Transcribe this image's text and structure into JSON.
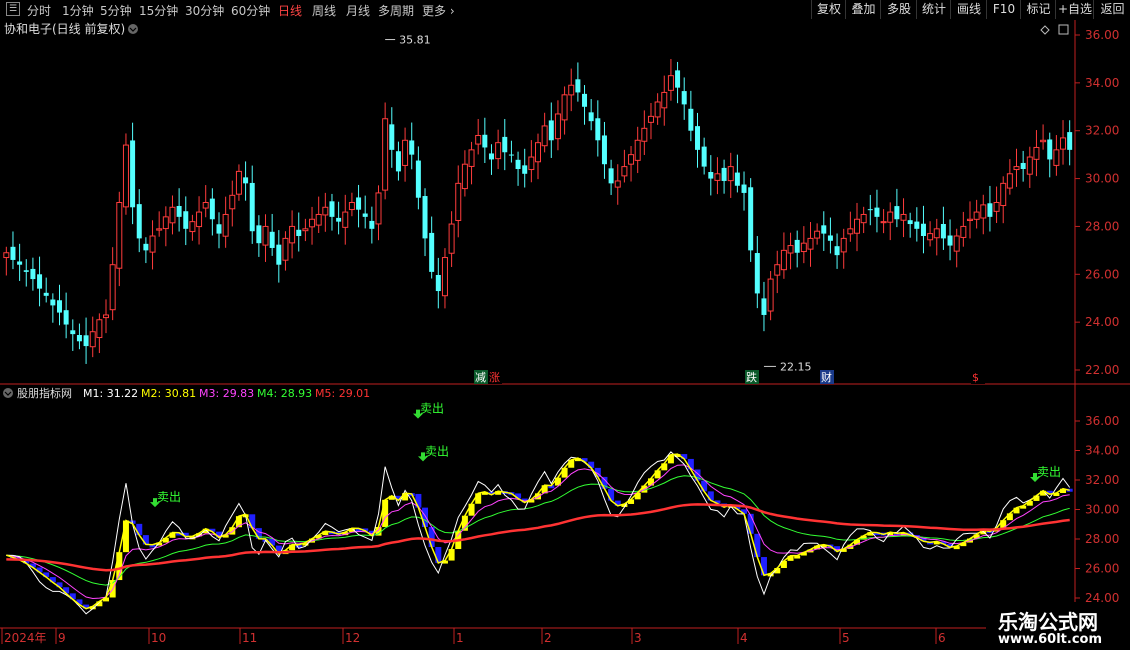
{
  "toolbar": {
    "left": [
      "分时",
      "1分钟",
      "5分钟",
      "15分钟",
      "30分钟",
      "60分钟",
      "日线",
      "周线",
      "月线",
      "多周期",
      "更多"
    ],
    "active": "日线",
    "right": [
      "复权",
      "叠加",
      "多股",
      "统计",
      "画线",
      "F10",
      "标记",
      "+自选",
      "返回"
    ]
  },
  "main_title": "协和电子(日线 前复权)",
  "ind_title": "股朋指标网",
  "ind_values": [
    {
      "label": "M1: 31.22",
      "color": "#ffffff"
    },
    {
      "label": "M2: 30.81",
      "color": "#ffff00"
    },
    {
      "label": "M3: 29.83",
      "color": "#ff44ff"
    },
    {
      "label": "M4: 28.93",
      "color": "#33ff33"
    },
    {
      "label": "M5: 29.01",
      "color": "#ff3333"
    }
  ],
  "watermark": {
    "line1": "乐淘公式网",
    "line2": "www.60lt.com"
  },
  "chart_data": [
    {
      "type": "candlestick",
      "ylim": [
        21.5,
        36.5
      ],
      "yticks": [
        "36.00",
        "34.00",
        "32.00",
        "30.00",
        "28.00",
        "26.00",
        "24.00",
        "22.00"
      ],
      "annotations": {
        "high": "35.81",
        "low": "22.15"
      },
      "markers": [
        "减",
        "涨",
        "跌",
        "财",
        "$"
      ],
      "close": [
        26.9,
        26.6,
        26.4,
        26.1,
        25.8,
        25.4,
        25.1,
        24.7,
        24.4,
        23.9,
        23.5,
        23.2,
        23.0,
        23.6,
        24.1,
        24.3,
        26.4,
        29.0,
        31.4,
        28.8,
        27.5,
        27.0,
        27.6,
        27.9,
        28.4,
        28.8,
        28.4,
        27.9,
        28.2,
        28.6,
        29.0,
        28.3,
        27.7,
        28.5,
        29.3,
        30.3,
        29.8,
        27.8,
        27.3,
        28.0,
        27.1,
        26.4,
        27.5,
        28.0,
        27.6,
        27.9,
        28.3,
        28.5,
        28.8,
        28.4,
        28.2,
        28.6,
        29.0,
        28.7,
        28.4,
        27.9,
        29.4,
        32.5,
        31.2,
        30.3,
        31.6,
        31.0,
        29.2,
        27.5,
        26.1,
        25.3,
        26.7,
        28.1,
        29.8,
        30.6,
        31.2,
        31.8,
        31.3,
        30.8,
        31.5,
        31.1,
        31.0,
        30.4,
        30.2,
        30.9,
        31.5,
        32.2,
        31.6,
        32.7,
        33.5,
        33.9,
        33.6,
        33.0,
        32.4,
        31.6,
        30.6,
        29.8,
        29.9,
        30.5,
        31.0,
        31.6,
        32.1,
        32.6,
        33.2,
        33.6,
        34.3,
        33.8,
        33.1,
        32.0,
        31.2,
        30.5,
        30.0,
        30.2,
        29.9,
        30.5,
        29.7,
        29.4,
        27.0,
        25.2,
        24.3,
        25.8,
        26.4,
        27.0,
        27.2,
        26.9,
        27.3,
        27.5,
        27.8,
        27.7,
        27.4,
        26.8,
        27.5,
        27.9,
        28.3,
        28.5,
        28.7,
        28.4,
        28.2,
        28.6,
        28.3,
        28.5,
        28.1,
        27.9,
        27.6,
        27.7,
        27.9,
        27.5,
        27.2,
        27.6,
        28.0,
        28.3,
        28.6,
        28.9,
        28.4,
        29.0,
        29.8,
        30.2,
        30.5,
        30.4,
        30.9,
        31.3,
        31.6,
        30.8,
        31.2,
        31.7,
        31.2
      ]
    },
    {
      "type": "line",
      "series": [
        {
          "name": "M1",
          "color": "#ffffff"
        },
        {
          "name": "M2",
          "color": "#ffff00"
        },
        {
          "name": "M3",
          "color": "#ff44ff"
        },
        {
          "name": "M4",
          "color": "#33ff33"
        },
        {
          "name": "M5",
          "color": "#ff3333"
        }
      ],
      "yticks": [
        "36.00",
        "34.00",
        "32.00",
        "30.00",
        "28.00",
        "26.00",
        "24.00"
      ],
      "signal_label": "卖出",
      "signals": [
        {
          "x": "10",
          "y": 30.5
        },
        {
          "x": "12",
          "y": 36.5
        },
        {
          "x": "12",
          "y": 33.6
        },
        {
          "x": "6",
          "y": 32.2
        }
      ],
      "xticks": [
        "2024年",
        "9",
        "10",
        "11",
        "12",
        "1",
        "2",
        "3",
        "4",
        "5",
        "6"
      ]
    }
  ]
}
